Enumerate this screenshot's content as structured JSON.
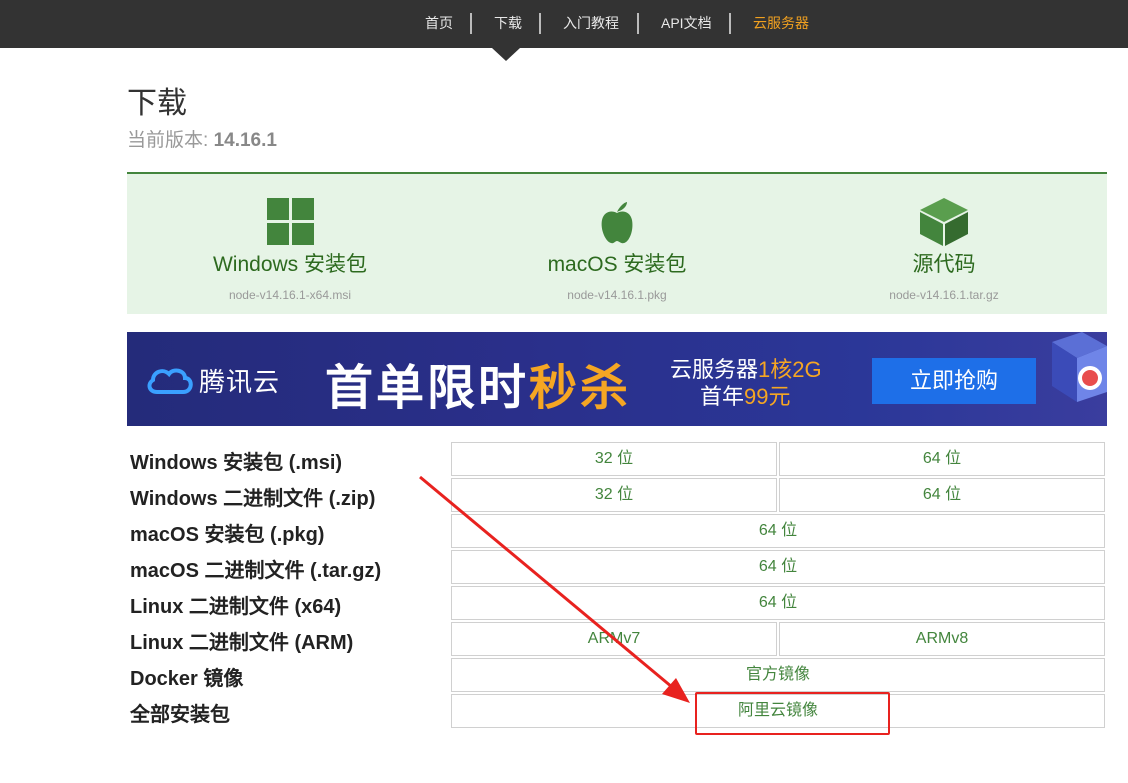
{
  "nav": {
    "items": [
      {
        "label": "首页"
      },
      {
        "label": "下载"
      },
      {
        "label": "入门教程"
      },
      {
        "label": "API文档"
      },
      {
        "label": "云服务器"
      }
    ]
  },
  "header": {
    "title": "下载",
    "version_prefix": "当前版本:",
    "version": "14.16.1"
  },
  "downloads": [
    {
      "icon": "windows-icon",
      "label": "Windows 安装包",
      "file": "node-v14.16.1-x64.msi"
    },
    {
      "icon": "apple-icon",
      "label": "macOS 安装包",
      "file": "node-v14.16.1.pkg"
    },
    {
      "icon": "source-box-icon",
      "label": "源代码",
      "file": "node-v14.16.1.tar.gz"
    }
  ],
  "banner": {
    "brand": "腾讯云",
    "headline_a": "首单限时",
    "headline_b": "秒杀",
    "sub1_a": "云服务器",
    "sub1_b": "1核2G",
    "sub2_a": "首年",
    "sub2_b": "99元",
    "cta": "立即抢购"
  },
  "table": {
    "rows": [
      {
        "label": "Windows 安装包 (.msi)",
        "cells": [
          "32 位",
          "64 位"
        ]
      },
      {
        "label": "Windows 二进制文件 (.zip)",
        "cells": [
          "32 位",
          "64 位"
        ]
      },
      {
        "label": "macOS 安装包 (.pkg)",
        "cells": [
          "64 位"
        ]
      },
      {
        "label": "macOS 二进制文件 (.tar.gz)",
        "cells": [
          "64 位"
        ]
      },
      {
        "label": "Linux 二进制文件 (x64)",
        "cells": [
          "64 位"
        ]
      },
      {
        "label": "Linux 二进制文件 (ARM)",
        "cells": [
          "ARMv7",
          "ARMv8"
        ]
      },
      {
        "label": "Docker 镜像",
        "cells": [
          "官方镜像"
        ]
      },
      {
        "label": "全部安装包",
        "cells": [
          "阿里云镜像"
        ]
      }
    ]
  },
  "colors": {
    "nav_bg": "#333333",
    "accent_orange": "#f0a020",
    "node_green": "#43853d",
    "panel_bg": "#e6f4e6",
    "annotation_red": "#e8221f"
  }
}
